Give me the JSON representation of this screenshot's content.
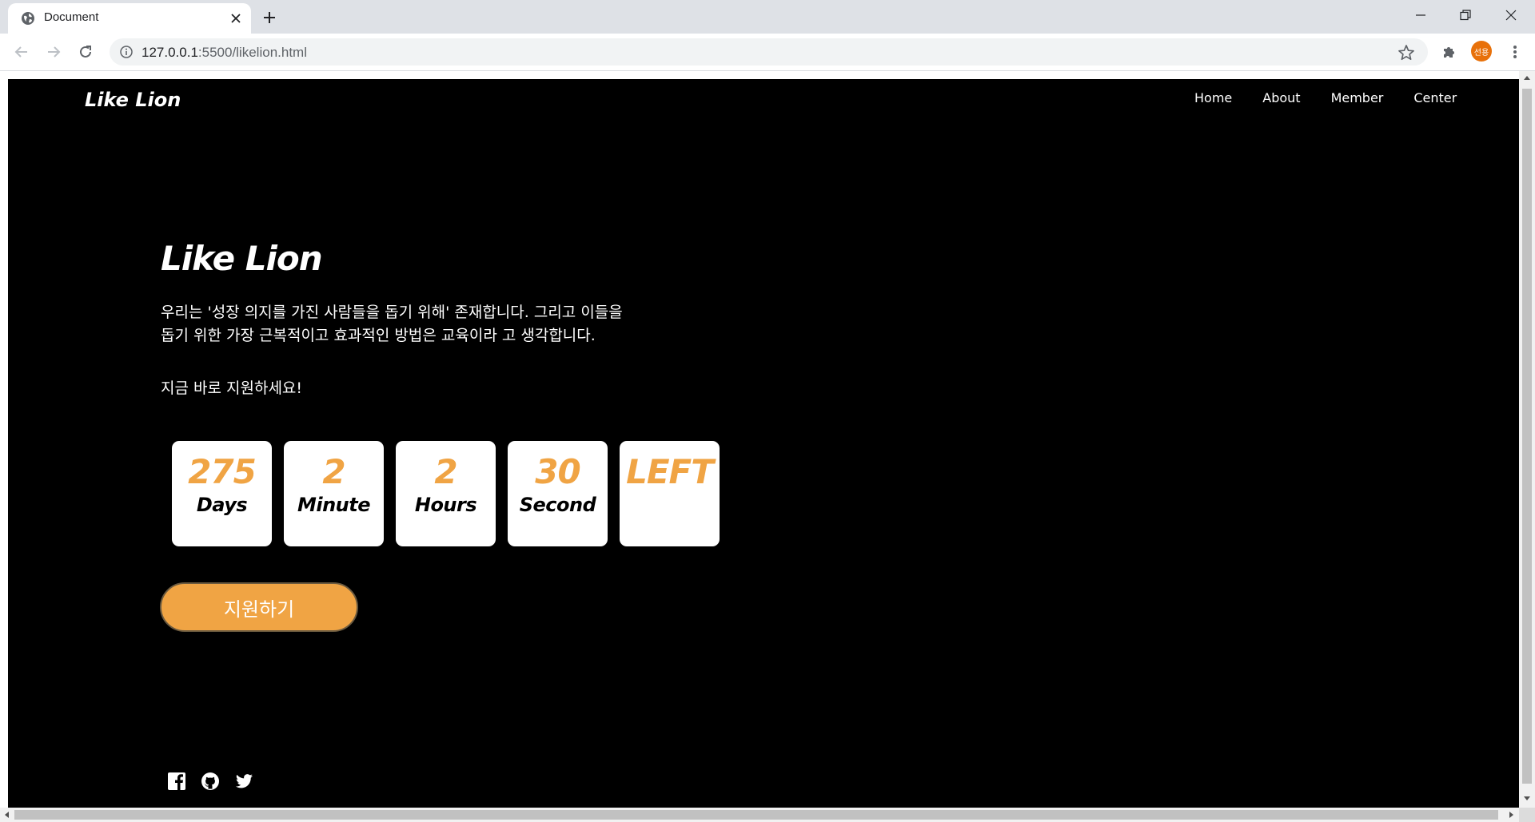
{
  "browser": {
    "tab_title": "Document",
    "url_host": "127.0.0.1",
    "url_rest": ":5500/likelion.html",
    "profile_initials": "선용"
  },
  "page": {
    "logo": "Like Lion",
    "nav": [
      "Home",
      "About",
      "Member",
      "Center"
    ],
    "hero": {
      "title": "Like Lion",
      "text_line1": "우리는 '성장 의지를 가진 사람들을 돕기 위해' 존재합니다. 그리고 이들을",
      "text_line2": "돕기 위한 가장 근복적이고 효과적인 방법은 교육이라 고 생각합니다.",
      "cta_text": "지금 바로 지원하세요!"
    },
    "countdown": [
      {
        "value": "275",
        "label": "Days"
      },
      {
        "value": "2",
        "label": "Minute"
      },
      {
        "value": "2",
        "label": "Hours"
      },
      {
        "value": "30",
        "label": "Second"
      },
      {
        "value": "LEFT",
        "label": ""
      }
    ],
    "apply_button": "지원하기",
    "social_icons": [
      "facebook-icon",
      "github-icon",
      "twitter-icon"
    ]
  },
  "colors": {
    "accent": "#f0a444",
    "page_background": "#000000",
    "box_background": "#ffffff",
    "avatar": "#e8710a"
  }
}
